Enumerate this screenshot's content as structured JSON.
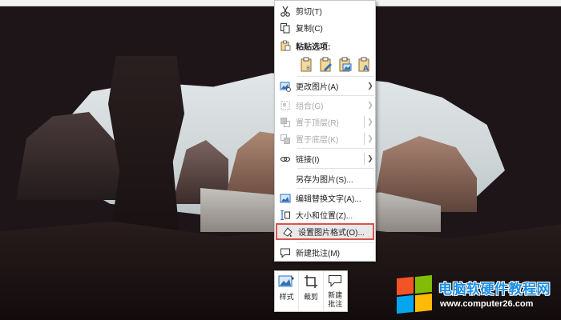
{
  "context_menu": {
    "cut": "剪切(T)",
    "copy": "复制(C)",
    "paste_options": "粘贴选项:",
    "change_picture": "更改图片(A)",
    "group": "组合(G)",
    "bring_to_front": "置于顶层(R)",
    "send_to_back": "置于底层(K)",
    "link": "链接(I)",
    "save_as_picture": "另存为图片(S)...",
    "edit_alt_text": "编辑替换文字(A)...",
    "size_and_position": "大小和位置(Z)...",
    "format_picture": "设置图片格式(O)...",
    "new_comment": "新建批注(M)"
  },
  "mini_toolbar": {
    "style": "样式",
    "crop": "裁剪",
    "new_comment": "新建批注"
  },
  "watermark": {
    "title": "电脑软硬件教程网",
    "url": "www.computer26.com"
  },
  "colors": {
    "highlight_border": "#d9534f",
    "icon_blue": "#2f6fb7",
    "watermark_blue": "#1c8de3"
  }
}
